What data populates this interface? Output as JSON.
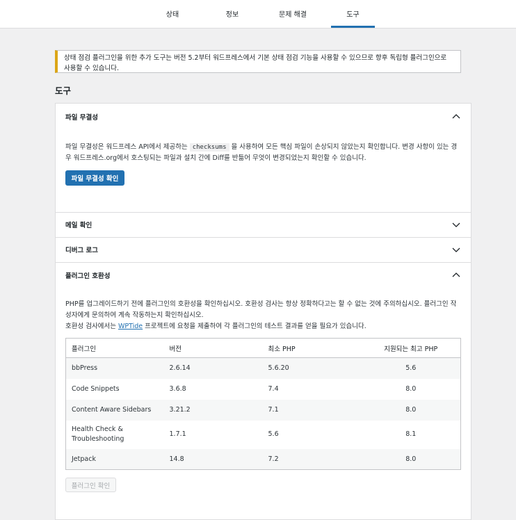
{
  "tabs": [
    {
      "label": "상태",
      "active": false
    },
    {
      "label": "정보",
      "active": false
    },
    {
      "label": "문제 해결",
      "active": false
    },
    {
      "label": "도구",
      "active": true
    }
  ],
  "notice": {
    "text": "상태 점검 플러그인을 위한 추가 도구는 버전 5.2부터 워드프레스에서 기본 상태 점검 기능을 사용할 수 있으므로 향후 독립형 플러그인으로 사용할 수 있습니다.",
    "accent_color": "#dba617"
  },
  "section_title": "도구",
  "file_integrity": {
    "title": "파일 무결성",
    "text_before": "파일 무결성은 워드프레스 API에서 제공하는 ",
    "code": "checksums",
    "text_after": " 을 사용하여 모든 핵심 파일이 손상되지 않았는지 확인합니다. 변경 사항이 있는 경우 워드프레스.org에서 호스팅되는 파일과 설치 간에 Diff를 반듦어 무엇이 변경되었는지 확인할 수 있습니다.",
    "button": "파일 무결성 확인",
    "expanded": true
  },
  "mail_check": {
    "title": "메일 확인",
    "expanded": false
  },
  "debug_log": {
    "title": "디버그 로그",
    "expanded": false
  },
  "plugin_compat": {
    "title": "플러그인 호환성",
    "expanded": true,
    "desc1": "PHP를 업그레이드하기 전에 플러그인의 호환성을 확인하십시오. 호환성 검사는 항상 정확하다고는 할 수 없는 것에 주의하십시오. 플러그인 작성자에게 문의하여 계속 작동하는지 확인하십시오.",
    "desc2_before": "호환성 검사에서는 ",
    "desc2_link": "WPTide",
    "desc2_after": " 프로젝트에 요청을 제출하여 각 플러그인의 테스트 결과를 얻을 필요가 있습니다.",
    "columns": [
      "플러그인",
      "버전",
      "최소 PHP",
      "지원되는 최고 PHP"
    ],
    "rows": [
      [
        "bbPress",
        "2.6.14",
        "5.6.20",
        "5.6"
      ],
      [
        "Code Snippets",
        "3.6.8",
        "7.4",
        "8.0"
      ],
      [
        "Content Aware Sidebars",
        "3.21.2",
        "7.1",
        "8.0"
      ],
      [
        "Health Check & Troubleshooting",
        "1.7.1",
        "5.6",
        "8.1"
      ],
      [
        "Jetpack",
        "14.8",
        "7.2",
        "8.0"
      ]
    ],
    "button": "플러그인 확인"
  },
  "colors": {
    "primary": "#2271b1",
    "border": "#dcdcde",
    "background": "#f0f0f1"
  }
}
